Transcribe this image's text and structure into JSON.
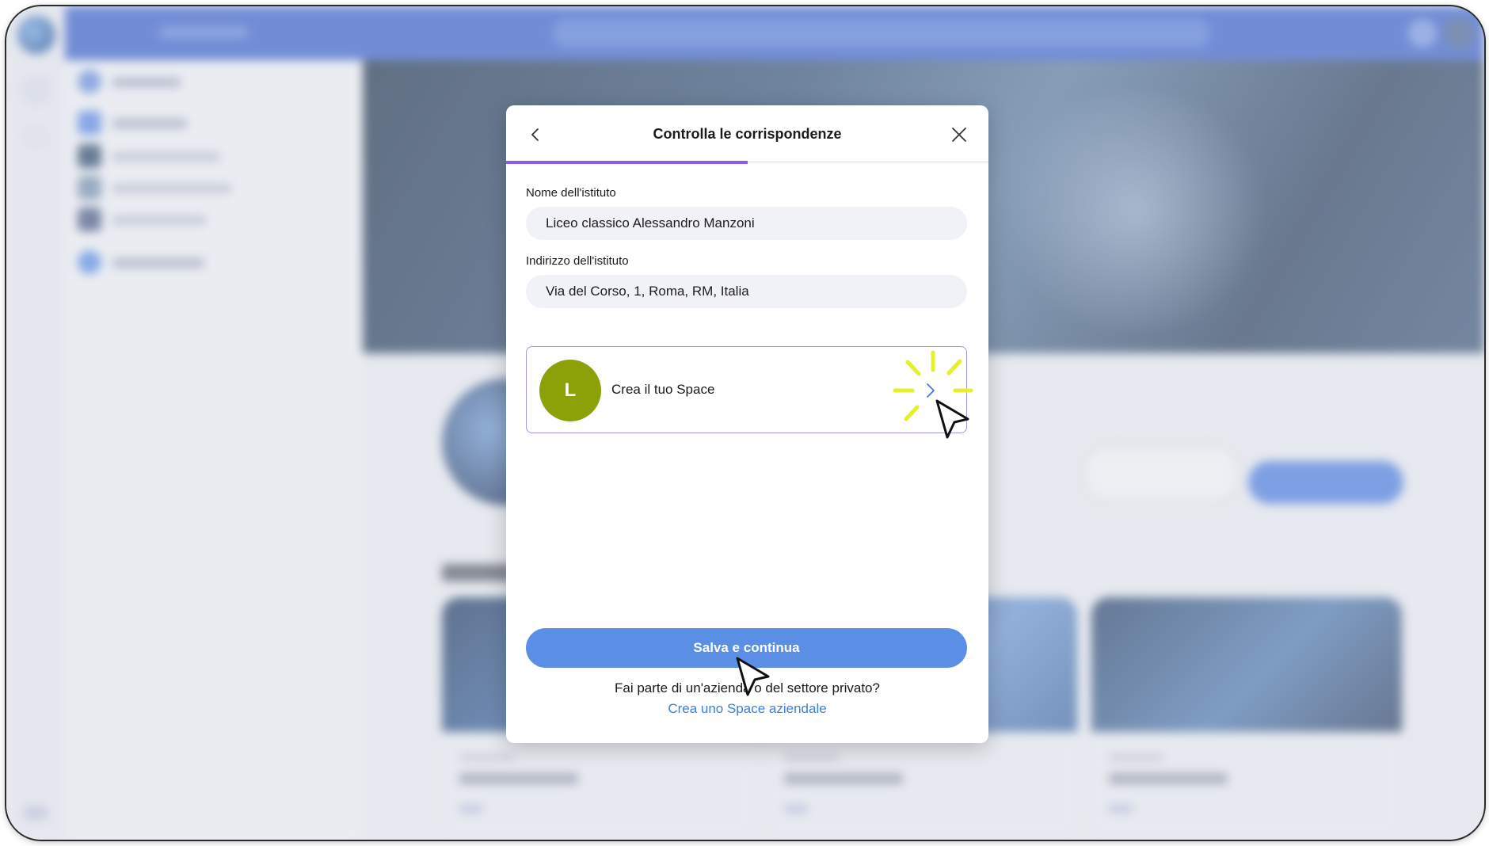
{
  "modal": {
    "title": "Controlla le corrispondenze",
    "progress_fraction": 0.5,
    "institute_name_label": "Nome dell'istituto",
    "institute_name_value": "Liceo classico Alessandro Manzoni",
    "institute_address_label": "Indirizzo dell'istituto",
    "institute_address_value": "Via del Corso, 1, Roma, RM, Italia",
    "space_card": {
      "avatar_letter": "L",
      "avatar_color": "#8ba107",
      "label": "Crea il tuo Space"
    },
    "save_button_label": "Salva e continua",
    "private_sector_question": "Fai parte di un'azienda o del settore privato?",
    "business_space_link": "Crea uno Space aziendale"
  },
  "icons": {
    "back": "chevron-left-icon",
    "close": "close-icon",
    "space_card_arrow": "chevron-right-icon",
    "pointer": "cursor-pointer-icon",
    "highlight": "click-sparkle-icon"
  },
  "colors": {
    "accent_purple": "#8b5cf0",
    "primary_blue": "#5b8fe6",
    "link_blue": "#3c7fe0",
    "app_header_blue": "#2b55c7",
    "sparkle_yellow": "#e6f02a"
  }
}
